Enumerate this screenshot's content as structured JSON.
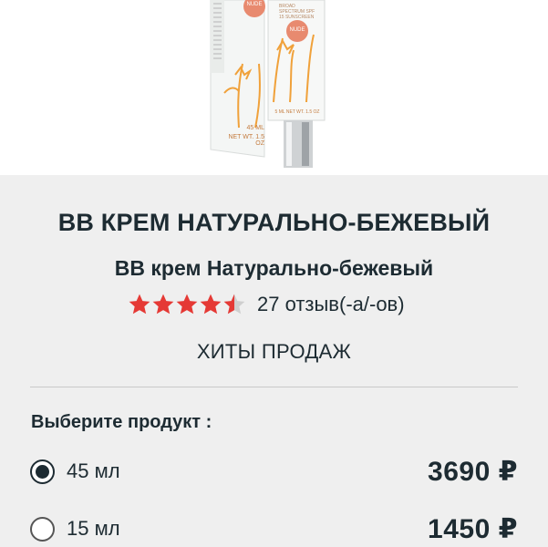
{
  "product_image": {
    "box_badge": "NUDE",
    "tube_badge": "NUDE",
    "box_volume": "45 ML",
    "box_net_weight": "NET WT. 1.5 OZ",
    "tube_small_text": "BROAD SPECTRUM SPF 15 SUNSCREEN",
    "tube_volume": "5 ML NET WT. 1.5 OZ"
  },
  "product": {
    "title": "ВВ КРЕМ НАТУРАЛЬНО-БЕЖЕВЫЙ",
    "subtitle": "ВВ крем Натурально-бежевый",
    "rating": 4.5,
    "rating_max": 5,
    "reviews_label": "27 отзыв(-а/-ов)",
    "badge": "ХИТЫ ПРОДАЖ"
  },
  "colors": {
    "star_filled": "#e53935",
    "star_empty": "#cfcfcf",
    "text": "#1d2b32",
    "background": "#efefef"
  },
  "selector": {
    "label": "Выберите продукт :",
    "options": [
      {
        "size": "45 мл",
        "price": "3690 ₽",
        "selected": true
      },
      {
        "size": "15 мл",
        "price": "1450 ₽",
        "selected": false
      }
    ]
  }
}
